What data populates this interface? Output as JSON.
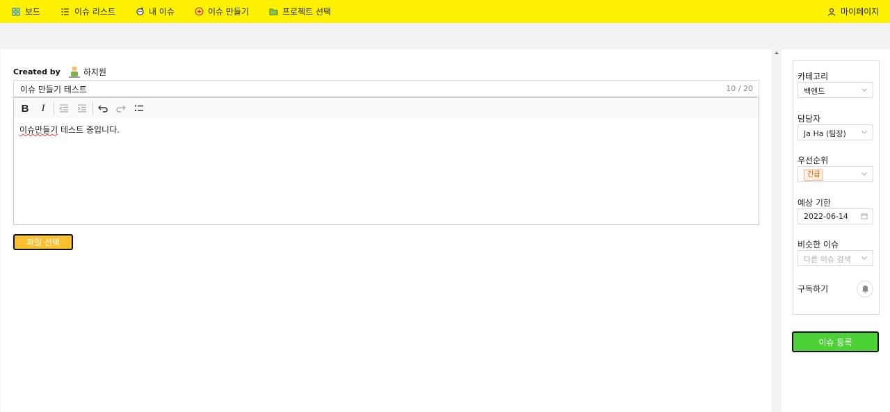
{
  "nav": {
    "items": [
      {
        "label": "보드",
        "icon": "grid-icon"
      },
      {
        "label": "이슈 리스트",
        "icon": "list-icon"
      },
      {
        "label": "내 이슈",
        "icon": "user-issue-icon"
      },
      {
        "label": "이슈 만들기",
        "icon": "plus-circle-icon"
      },
      {
        "label": "프로젝트 선택",
        "icon": "folder-icon"
      }
    ],
    "mypage": {
      "label": "마이페이지",
      "icon": "user-icon"
    }
  },
  "issue": {
    "created_by_label": "Created by",
    "creator_name": "하지원",
    "title": "이슈 만들기 테스트",
    "title_count": "10 / 20",
    "body_misspelled": "이슈만들기",
    "body_rest": " 테스트 중입니다."
  },
  "editor_toolbar": [
    "bold",
    "italic",
    "outdent",
    "indent",
    "undo",
    "redo",
    "bullet-list"
  ],
  "file_button": "파일 선택",
  "sidebar": {
    "category": {
      "label": "카테고리",
      "value": "백엔드"
    },
    "assignee": {
      "label": "담당자",
      "value": "Ja Ha (팀장)"
    },
    "priority": {
      "label": "우선순위",
      "value": "긴급"
    },
    "due": {
      "label": "예상 기한",
      "value": "2022-06-14"
    },
    "similar": {
      "label": "비슷한 이슈",
      "placeholder": "다른 이슈 검색"
    },
    "subscribe": {
      "label": "구독하기"
    }
  },
  "submit_button": "이슈 등록",
  "colors": {
    "nav_bg": "#fff200",
    "file_button_bg": "#fbc02d",
    "submit_bg": "#4cd137",
    "urgent_tag": "#e65100"
  }
}
